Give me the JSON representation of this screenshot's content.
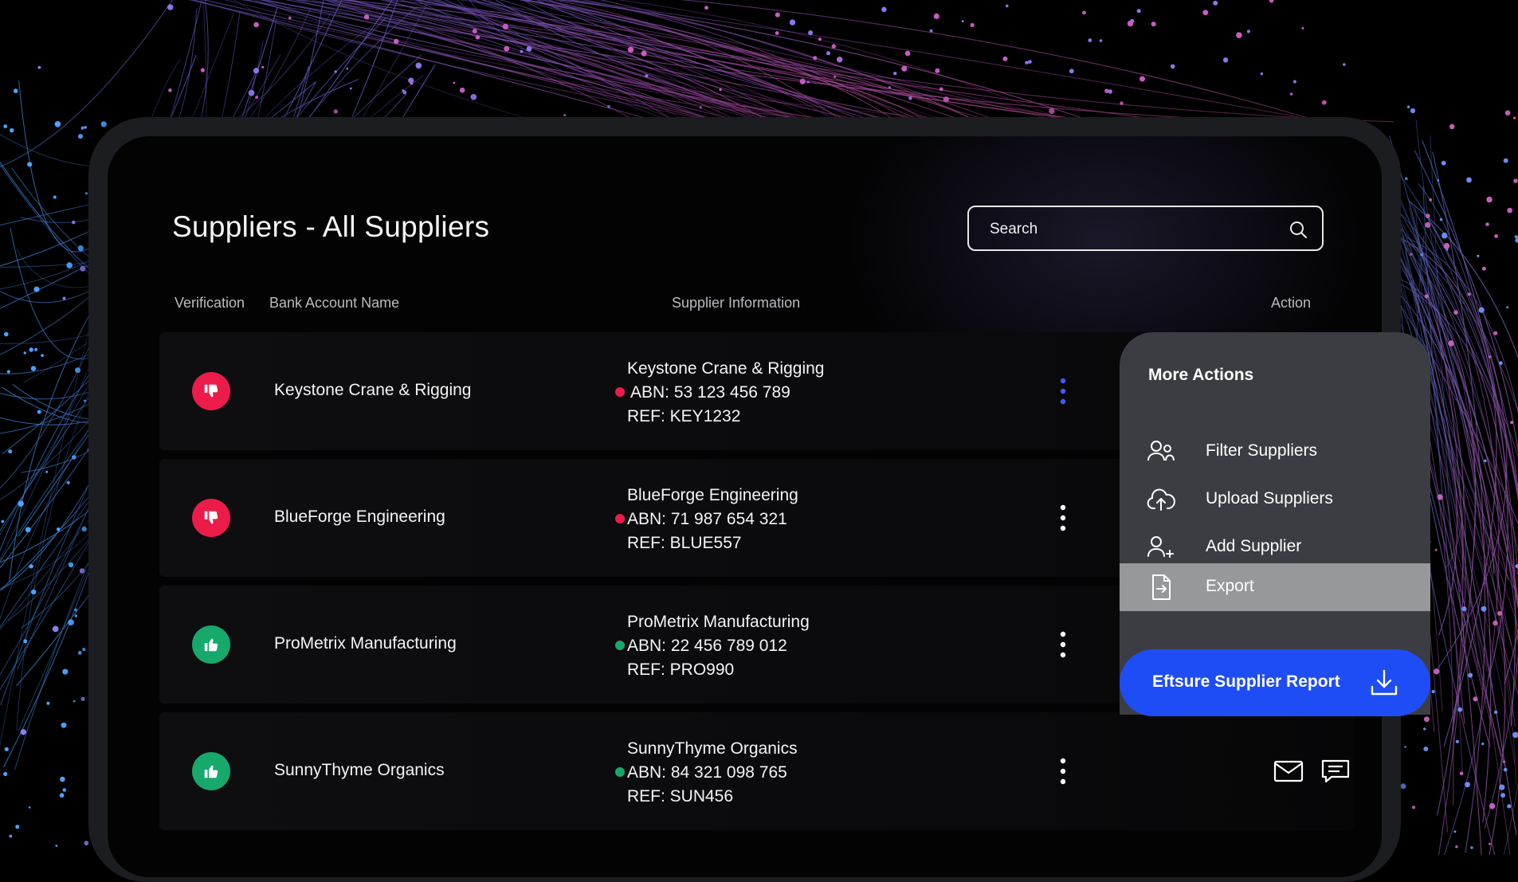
{
  "page": {
    "title": "Suppliers - All Suppliers"
  },
  "search": {
    "placeholder": "Search"
  },
  "columns": {
    "verification": "Verification",
    "bank_account_name": "Bank Account Name",
    "supplier_information": "Supplier Information",
    "action": "Action"
  },
  "rows": [
    {
      "verification": "failed",
      "verification_icon": "thumbs-down-icon",
      "bank_account_name": "Keystone Crane & Rigging",
      "supplier_name": "Keystone Crane & Rigging",
      "abn": "ABN: 53 123 456 789",
      "ref": "REF: KEY1232",
      "status_color": "#ec1c4a",
      "menu_open": true
    },
    {
      "verification": "failed",
      "verification_icon": "thumbs-down-icon",
      "bank_account_name": "BlueForge Engineering",
      "supplier_name": "BlueForge Engineering",
      "abn": "ABN: 71 987 654 321",
      "ref": "REF: BLUE557",
      "status_color": "#ec1c4a",
      "menu_open": false
    },
    {
      "verification": "passed",
      "verification_icon": "thumbs-up-icon",
      "bank_account_name": "ProMetrix Manufacturing",
      "supplier_name": "ProMetrix Manufacturing",
      "abn": "ABN: 22 456 789 012",
      "ref": "REF: PRO990",
      "status_color": "#17a86b",
      "menu_open": false
    },
    {
      "verification": "passed",
      "verification_icon": "thumbs-up-icon",
      "bank_account_name": "SunnyThyme Organics",
      "supplier_name": "SunnyThyme Organics",
      "abn": "ABN: 84 321 098 765",
      "ref": "REF: SUN456",
      "status_color": "#17a86b",
      "menu_open": false,
      "actions": [
        "mail-icon",
        "message-icon"
      ]
    }
  ],
  "more_actions": {
    "title": "More Actions",
    "items": [
      {
        "label": "Filter Suppliers",
        "icon": "users-filter-icon",
        "active": false
      },
      {
        "label": "Upload Suppliers",
        "icon": "cloud-upload-icon",
        "active": false
      },
      {
        "label": "Add Supplier",
        "icon": "add-user-icon",
        "active": false
      },
      {
        "label": "Export",
        "icon": "export-file-icon",
        "active": true
      }
    ],
    "report_button": {
      "label": "Eftsure Supplier Report",
      "icon": "download-icon"
    }
  },
  "colors": {
    "accent_blue": "#1f4df5",
    "fail_red": "#ec1c4a",
    "pass_green": "#17a86b",
    "kebab_active": "#3d5cff",
    "menu_bg": "#3c3d42",
    "menu_active_bg": "#97989b"
  }
}
